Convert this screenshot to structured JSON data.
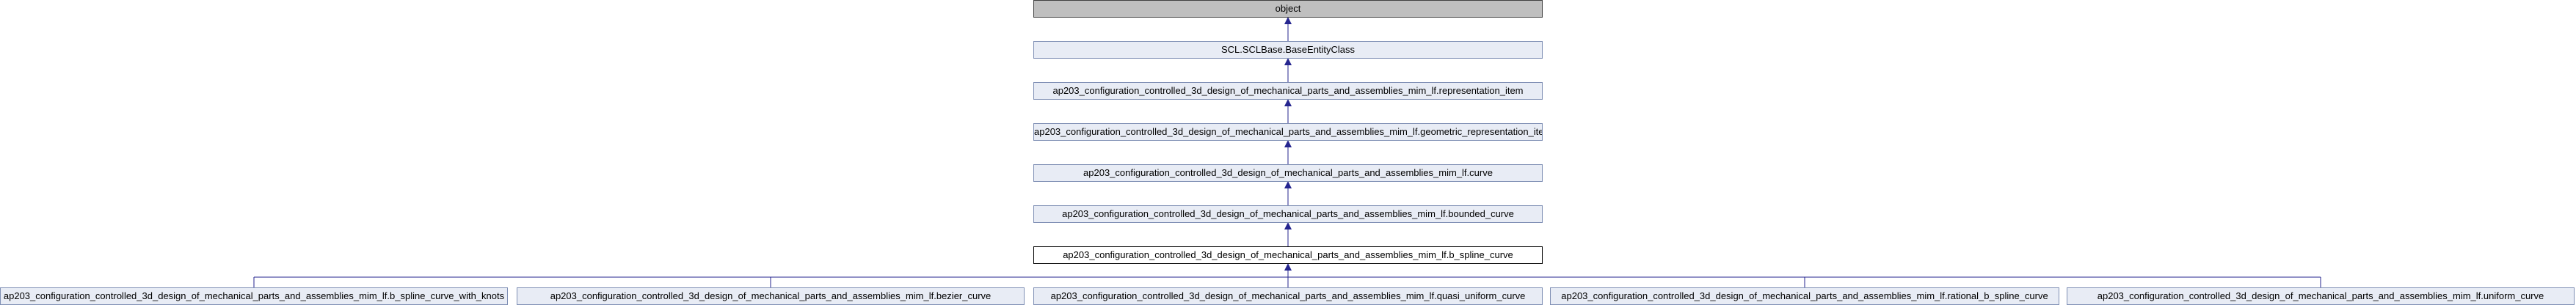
{
  "diagram": {
    "chain": [
      "object",
      "SCL.SCLBase.BaseEntityClass",
      "ap203_configuration_controlled_3d_design_of_mechanical_parts_and_assemblies_mim_lf.representation_item",
      "ap203_configuration_controlled_3d_design_of_mechanical_parts_and_assemblies_mim_lf.geometric_representation_item",
      "ap203_configuration_controlled_3d_design_of_mechanical_parts_and_assemblies_mim_lf.curve",
      "ap203_configuration_controlled_3d_design_of_mechanical_parts_and_assemblies_mim_lf.bounded_curve",
      "ap203_configuration_controlled_3d_design_of_mechanical_parts_and_assemblies_mim_lf.b_spline_curve"
    ],
    "children": [
      "ap203_configuration_controlled_3d_design_of_mechanical_parts_and_assemblies_mim_lf.b_spline_curve_with_knots",
      "ap203_configuration_controlled_3d_design_of_mechanical_parts_and_assemblies_mim_lf.bezier_curve",
      "ap203_configuration_controlled_3d_design_of_mechanical_parts_and_assemblies_mim_lf.quasi_uniform_curve",
      "ap203_configuration_controlled_3d_design_of_mechanical_parts_and_assemblies_mim_lf.rational_b_spline_curve",
      "ap203_configuration_controlled_3d_design_of_mechanical_parts_and_assemblies_mim_lf.uniform_curve"
    ],
    "colors": {
      "edge": "#25258f",
      "root_fill": "#bfbfbf",
      "node_fill": "#e8ecf5",
      "node_border": "#7f8fb4",
      "focus_border": "#000000"
    }
  }
}
